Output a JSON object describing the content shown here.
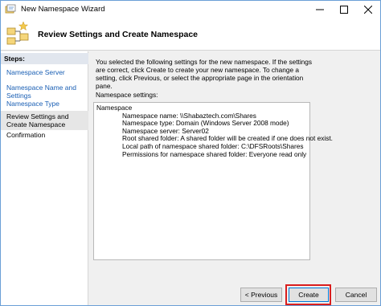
{
  "window": {
    "title": "New Namespace Wizard"
  },
  "header": {
    "title": "Review Settings and Create Namespace"
  },
  "sidebar": {
    "heading": "Steps:",
    "items": [
      {
        "label": "Namespace Server",
        "state": "link"
      },
      {
        "label": "Namespace Name and Settings",
        "state": "link"
      },
      {
        "label": "Namespace Type",
        "state": "link"
      },
      {
        "label": "Review Settings and Create Namespace",
        "state": "current"
      },
      {
        "label": "Confirmation",
        "state": "plain"
      }
    ]
  },
  "main": {
    "description": "You selected the following settings for the new namespace. If the settings are correct, click Create to create your new namespace. To change a setting, click Previous, or select the appropriate page in the orientation pane.",
    "settings_label": "Namespace settings:",
    "settings_heading": "Namespace",
    "settings_lines": [
      "Namespace name:  \\\\Shabaztech.com\\Shares",
      "Namespace type:  Domain (Windows Server 2008 mode)",
      "Namespace server: Server02",
      "Root shared folder:  A shared folder will be created if one does not exist.",
      "Local path of namespace shared folder: C:\\DFSRoots\\Shares",
      "Permissions for namespace shared folder: Everyone read only"
    ]
  },
  "footer": {
    "previous_label": "< Previous",
    "create_label": "Create",
    "cancel_label": "Cancel"
  },
  "colors": {
    "highlight": "#d91e1e",
    "link": "#1a5fb4",
    "accent": "#0078d7"
  }
}
